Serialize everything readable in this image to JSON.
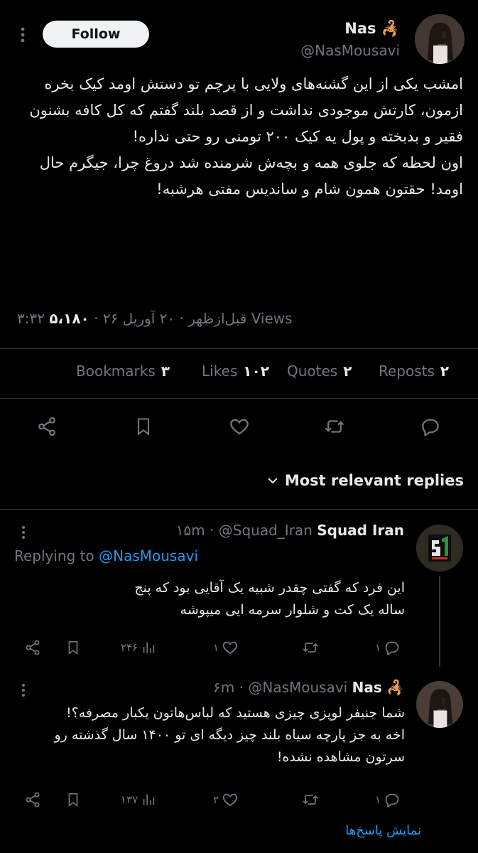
{
  "post": {
    "author_name": "Nas",
    "author_emoji": "🦂",
    "handle": "@NasMousavi",
    "follow_label": "Follow",
    "body": "امشب یکی از این گشنه‌های ولایی با پرچم تو دستش اومد کیک بخره ازمون، کارتش موجودی نداشت و از قصد بلند گفتم که کل کافه بشنون فقیر و بدبخته و پول یه کیک ۲۰۰ تومنی رو حتی نداره!\nاون لحظه که جلوی همه و بچه‌ش شرمنده شد دروغ چرا، جیگرم حال اومد! حقتون همون شام و ساندیس مفتی هرشبه!",
    "timestamp": "۳:۳۲ قبل‌ازظهر · ۲۰ آوریل ۲۶",
    "views_count": "۵،۱۸۰",
    "views_label": "Views",
    "separator": "·",
    "stats": {
      "bookmarks_label": "Bookmarks",
      "bookmarks_count": "۳",
      "likes_label": "Likes",
      "likes_count": "۱۰۲",
      "quotes_label": "Quotes",
      "quotes_count": "۲",
      "reposts_label": "Reposts",
      "reposts_count": "۲"
    }
  },
  "replies_sort_label": "Most relevant replies",
  "replies": [
    {
      "name": "Squad Iran",
      "handle": "@Squad_Iran",
      "time": "۱۵m",
      "replying_prefix": "Replying to",
      "replying_handle": "@NasMousavi",
      "text": "این فرد که گفتی چقدر شبیه یک آقایی بود که پنج ساله یک کت و شلوار سرمه ایی میپوشه",
      "views": "۲۴۶",
      "likes": "۱",
      "replies_count": "۱"
    },
    {
      "name": "Nas",
      "emoji": "🦂",
      "handle": "@NasMousavi",
      "time": "۶m",
      "text": "شما جنیفر لوپزی چیزی هستید که لباس‌هاتون یکبار مصرفه؟! اخه به جز پارچه سیاه بلند چیز دیگه ای تو ۱۴۰۰ سال گذشته رو سرتون مشاهده نشده!",
      "views": "۱۳۷",
      "likes": "۲",
      "replies_count": "۱"
    }
  ],
  "show_replies_label": "نمایش پاسخ‌ها",
  "colors": {
    "background": "#000000",
    "text": "#e7e9ea",
    "muted": "#71767b",
    "accent": "#1d9bf0",
    "divider": "#2f3336"
  }
}
